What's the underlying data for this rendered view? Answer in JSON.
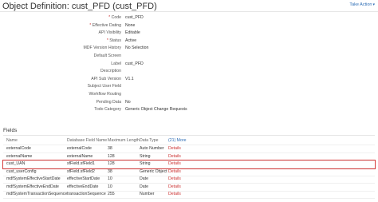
{
  "header": {
    "title": "Object Definition: cust_PFD (cust_PFD)",
    "take_action": "Take Action",
    "take_action_caret": "▾"
  },
  "properties": [
    {
      "label": "Code",
      "required": true,
      "value": "cust_PFD",
      "kind": "text"
    },
    {
      "label": "Effective Dating",
      "required": true,
      "value": "None",
      "kind": "select"
    },
    {
      "label": "API Visibility",
      "required": false,
      "value": "Editable",
      "kind": "select"
    },
    {
      "label": "Status",
      "required": true,
      "value": "Active",
      "kind": "select"
    },
    {
      "label": "MDF Version History",
      "required": false,
      "value": "No Selection",
      "kind": "select"
    },
    {
      "label": "Default Screen",
      "required": false,
      "value": "",
      "kind": "text"
    },
    {
      "label": "Label",
      "required": false,
      "value": "cust_PFD",
      "kind": "select"
    },
    {
      "label": "Description",
      "required": false,
      "value": "",
      "kind": "text"
    },
    {
      "label": "API Sub Version",
      "required": false,
      "value": "V1.1",
      "kind": "text"
    },
    {
      "label": "Subject User Field",
      "required": false,
      "value": "",
      "kind": "text"
    },
    {
      "label": "Workflow Routing",
      "required": false,
      "value": "",
      "kind": "text"
    },
    {
      "label": "Pending Data",
      "required": false,
      "value": "No",
      "kind": "text"
    },
    {
      "label": "Todo Category",
      "required": false,
      "value": "Generic Object Change Requests",
      "kind": "select"
    }
  ],
  "fields": {
    "heading": "Fields",
    "columns": [
      "Name",
      "Database Field Name",
      "Maximum Length",
      "Data Type",
      "(21) More"
    ],
    "rows": [
      {
        "name": "externalCode",
        "db": "externalCode",
        "maxlen": "38",
        "type": "Auto Number",
        "action": "Details"
      },
      {
        "name": "externalName",
        "db": "externalName",
        "maxlen": "128",
        "type": "String",
        "action": "Details"
      },
      {
        "name": "cust_UAN",
        "db": "sfField.sfField1",
        "maxlen": "128",
        "type": "String",
        "action": "Details"
      },
      {
        "name": "cust_userConfig",
        "db": "sfField.sfField2",
        "maxlen": "38",
        "type": "Generic Object",
        "action": "Details"
      },
      {
        "name": "mdfSystemEffectiveStartDate",
        "db": "effectiveStartDate",
        "maxlen": "10",
        "type": "Date",
        "action": "Details"
      },
      {
        "name": "mdfSystemEffectiveEndDate",
        "db": "effectiveEndDate",
        "maxlen": "10",
        "type": "Date",
        "action": "Details"
      },
      {
        "name": "mdfSystemTransactionSequence",
        "db": "transactionSequence",
        "maxlen": "255",
        "type": "Number",
        "action": "Details"
      }
    ]
  }
}
